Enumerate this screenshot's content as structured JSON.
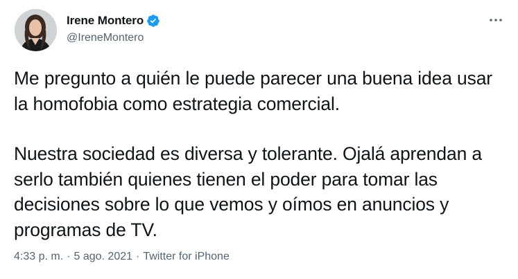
{
  "author": {
    "name": "Irene Montero",
    "handle": "@IreneMontero",
    "verified": true
  },
  "tweet": {
    "paragraphs": [
      "Me pregunto a quién le puede parecer una buena idea usar la homofobia como estrategia comercial.",
      "Nuestra sociedad es diversa y tolerante. Ojalá aprendan a serlo también quienes tienen el poder para tomar las decisiones sobre lo que vemos y oímos en anuncios y programas de TV."
    ]
  },
  "meta": {
    "time": "4:33 p. m.",
    "separator": "·",
    "date": "5 ago. 2021",
    "source": "Twitter for iPhone"
  },
  "icons": {
    "verified": "verified-badge-icon",
    "more": "more-options-icon"
  },
  "colors": {
    "text_primary": "#0f1419",
    "text_secondary": "#536471",
    "verified_blue": "#1d9bf0",
    "background": "#ffffff"
  }
}
